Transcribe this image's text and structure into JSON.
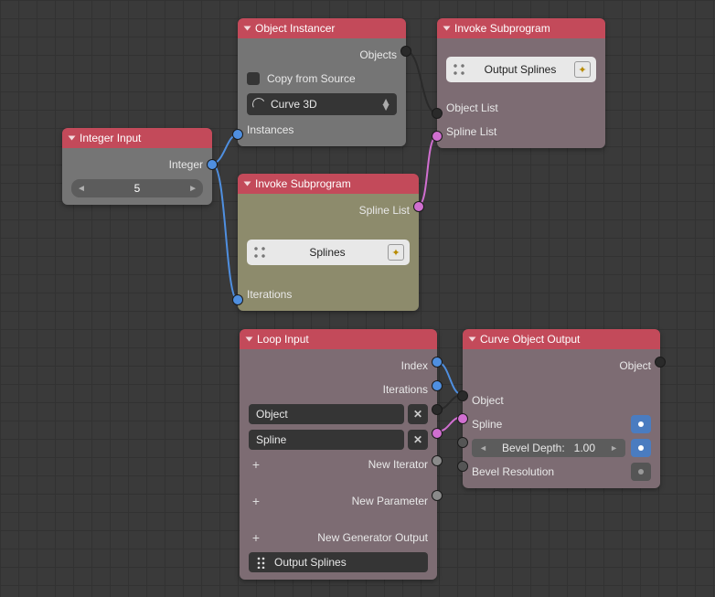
{
  "integer_input": {
    "title": "Integer Input",
    "out_label": "Integer",
    "value": "5"
  },
  "object_instancer": {
    "title": "Object Instancer",
    "out_objects": "Objects",
    "copy_label": "Copy from Source",
    "select_value": "Curve 3D",
    "in_instances": "Instances"
  },
  "invoke_top": {
    "title": "Invoke Subprogram",
    "subprog_name": "Output Splines",
    "in_object_list": "Object List",
    "in_spline_list": "Spline List"
  },
  "invoke_mid": {
    "title": "Invoke Subprogram",
    "out_spline_list": "Spline List",
    "subprog_name": "Splines",
    "in_iterations": "Iterations"
  },
  "loop_input": {
    "title": "Loop Input",
    "out_index": "Index",
    "out_iterations": "Iterations",
    "param_object": "Object",
    "param_spline": "Spline",
    "new_iterator": "New Iterator",
    "new_parameter": "New Parameter",
    "new_gen_output": "New Generator Output",
    "output_splines": "Output Splines"
  },
  "curve_out": {
    "title": "Curve Object Output",
    "out_object": "Object",
    "in_object": "Object",
    "in_spline": "Spline",
    "bevel_depth_label": "Bevel Depth:",
    "bevel_depth_value": "1.00",
    "bevel_res": "Bevel Resolution"
  }
}
